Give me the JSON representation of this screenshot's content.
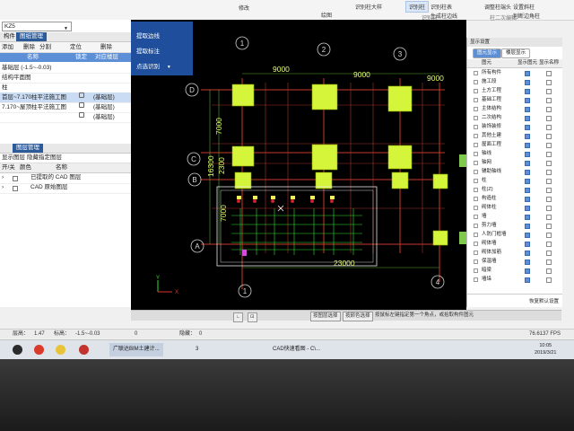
{
  "ribbon": {
    "items": [
      "修改",
      "绘图",
      "识别柱大样",
      "识别柱",
      "识别柱表",
      "生成柱边线",
      "调整柱端头",
      "设置斜柱",
      "判断边角柱",
      "柱二次编辑"
    ],
    "group_label": "识别柱",
    "active_label": "识别柱"
  },
  "left_panel": {
    "component_combo": "KZ5",
    "tabs": [
      "构件",
      "图纸管理"
    ],
    "toolbar": [
      "添加",
      "删除",
      "分割",
      "定位",
      "删除"
    ],
    "floor_columns": [
      "名称",
      "锁定",
      "对应楼层"
    ],
    "floors": [
      {
        "name": "基础层 (-1.5~-0.03)",
        "floor": ""
      },
      {
        "name": "结构平面图",
        "floor": ""
      },
      {
        "name": "柱",
        "floor": ""
      },
      {
        "name": "首层~7.170柱平法施工图",
        "floor": "(基础层)"
      },
      {
        "name": "7.170~屋顶柱平法施工图",
        "floor": "(基础层)"
      },
      {
        "name": "",
        "floor": "(基础层)"
      }
    ],
    "layer_tab": "图层管理",
    "layer_tools": [
      "显示图层",
      "隐藏指定图层"
    ],
    "layer_columns": [
      "开/关",
      "颜色",
      "名称"
    ],
    "layers": [
      {
        "name": "已提取的 CAD 图层"
      },
      {
        "name": "CAD 原始图层"
      }
    ]
  },
  "float_menu": {
    "items": [
      "提取边线",
      "提取标注",
      "点选识别"
    ]
  },
  "drawing": {
    "axis_labels_top": [
      "1",
      "2",
      "3"
    ],
    "axis_labels_bottom": [
      "1",
      "4"
    ],
    "axis_labels_left": [
      "D",
      "C",
      "B",
      "A"
    ],
    "dimensions": [
      "9000",
      "9000",
      "9000",
      "7000",
      "2300",
      "16300",
      "7000",
      "23000"
    ]
  },
  "right_panel": {
    "title": "显示设置",
    "tabs": [
      "图元显示",
      "楼层显示"
    ],
    "columns": [
      "图元",
      "显示图元",
      "显示名称"
    ],
    "items": [
      {
        "label": "所有构件",
        "show": true,
        "name": false
      },
      {
        "label": "施工段",
        "show": true,
        "name": false
      },
      {
        "label": "土方工程",
        "show": true,
        "name": false
      },
      {
        "label": "基础工程",
        "show": true,
        "name": false
      },
      {
        "label": "主体结构",
        "show": true,
        "name": false
      },
      {
        "label": "二次结构",
        "show": true,
        "name": false
      },
      {
        "label": "装饰装修",
        "show": true,
        "name": false
      },
      {
        "label": "其他土建",
        "show": true,
        "name": false
      },
      {
        "label": "屋面工程",
        "show": true,
        "name": false
      },
      {
        "label": "轴线",
        "show": true,
        "name": false
      },
      {
        "label": "轴网",
        "show": true,
        "name": false
      },
      {
        "label": "辅助轴线",
        "show": true,
        "name": false
      },
      {
        "label": "柱",
        "show": true,
        "name": false
      },
      {
        "label": "柱(Z)",
        "show": true,
        "name": false
      },
      {
        "label": "构造柱",
        "show": true,
        "name": false
      },
      {
        "label": "砌体柱",
        "show": true,
        "name": false
      },
      {
        "label": "墙",
        "show": true,
        "name": false
      },
      {
        "label": "剪力墙",
        "show": true,
        "name": false
      },
      {
        "label": "人防门框墙",
        "show": true,
        "name": false
      },
      {
        "label": "砌体墙",
        "show": true,
        "name": false
      },
      {
        "label": "砌体加筋",
        "show": true,
        "name": false
      },
      {
        "label": "保温墙",
        "show": true,
        "name": false
      },
      {
        "label": "暗梁",
        "show": true,
        "name": false
      },
      {
        "label": "墙垛",
        "show": true,
        "name": false
      }
    ],
    "footer": "恢复默认设置"
  },
  "command_bar": {
    "buttons": [
      "按图层选择",
      "按颜色选择"
    ],
    "hint": "按鼠标左键指定第一个角点，或拾取构件图元"
  },
  "status_bar": {
    "floor_height_label": "层高：",
    "floor_height": "1.47",
    "elevation_label": "标高：",
    "elevation": "-1.5~-0.03",
    "count": "0",
    "hidden_label": "隐藏：",
    "hidden": "0",
    "coords": "76.6137 FPS"
  },
  "taskbar": {
    "items": [
      "广联达BIM土建计...",
      "3",
      "CAD快速看图 - C\\..."
    ],
    "clock_time": "10:05",
    "clock_date": "2019/3/21"
  },
  "colors": {
    "canvas_bg": "#000000",
    "column_fill": "#d4f53a",
    "grid_line": "#c83a2a",
    "dimension_text": "#e6ff66",
    "menu_blue": "#1f4e9c",
    "selection_blue": "#5c8fd6"
  }
}
